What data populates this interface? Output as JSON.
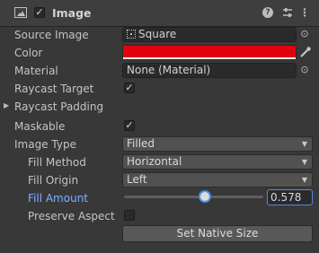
{
  "component": {
    "title": "Image",
    "enabled": true,
    "icons": {
      "component": "image-component-icon",
      "help": "help-icon",
      "presets": "presets-icon",
      "menu": "kebab-menu-icon"
    }
  },
  "fields": {
    "source_image": {
      "label": "Source Image",
      "value": "Square"
    },
    "color": {
      "label": "Color",
      "value": "#e3000f"
    },
    "material": {
      "label": "Material",
      "value": "None (Material)"
    },
    "raycast_target": {
      "label": "Raycast Target",
      "checked": true
    },
    "raycast_padding": {
      "label": "Raycast Padding",
      "expanded": false
    },
    "maskable": {
      "label": "Maskable",
      "checked": true
    },
    "image_type": {
      "label": "Image Type",
      "value": "Filled"
    },
    "fill_method": {
      "label": "Fill Method",
      "value": "Horizontal"
    },
    "fill_origin": {
      "label": "Fill Origin",
      "value": "Left"
    },
    "fill_amount": {
      "label": "Fill Amount",
      "value": "0.578",
      "fraction": 0.578
    },
    "preserve_aspect": {
      "label": "Preserve Aspect",
      "checked": false
    }
  },
  "set_native_size_label": "Set Native Size",
  "colors": {
    "accent": "#4d8ee0",
    "highlight_label": "#7fb0ff"
  }
}
